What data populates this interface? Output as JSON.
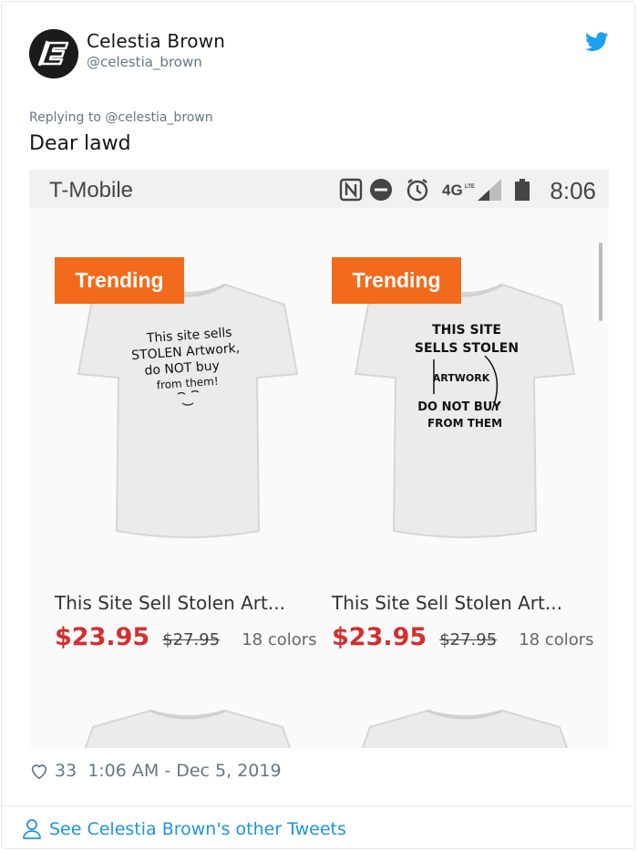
{
  "tweet": {
    "author_name": "Celestia Brown",
    "author_handle": "@celestia_brown",
    "replying_to": "Replying to @celestia_brown",
    "text": "Dear lawd",
    "likes": "33",
    "timestamp": "1:06 AM - Dec 5, 2019",
    "see_more": "See Celestia Brown's other Tweets"
  },
  "phone": {
    "carrier": "T-Mobile",
    "time": "8:06",
    "network": "4G",
    "network_sub": "LTE",
    "icons": [
      "nfc-icon",
      "dnd-icon",
      "alarm-icon",
      "signal-icon",
      "battery-icon"
    ]
  },
  "products": [
    {
      "badge": "Trending",
      "title": "This Site Sell Stolen Art...",
      "price": "$23.95",
      "old_price": "$27.95",
      "colors": "18 colors",
      "shirt_text": [
        "This site sells",
        "STOLEN Artwork,",
        "do NOT buy",
        "from them!"
      ]
    },
    {
      "badge": "Trending",
      "title": "This Site Sell Stolen Art...",
      "price": "$23.95",
      "old_price": "$27.95",
      "colors": "18 colors",
      "shirt_text": [
        "THIS SITE",
        "SELLS STOLEN",
        "ARTWORK",
        "DO NOT BUY",
        "FROM THEM"
      ]
    }
  ],
  "colors": {
    "twitter_blue": "#1da1f2",
    "link_blue": "#1b95e0",
    "badge_orange": "#f26a1b",
    "price_red": "#d32f2f"
  }
}
